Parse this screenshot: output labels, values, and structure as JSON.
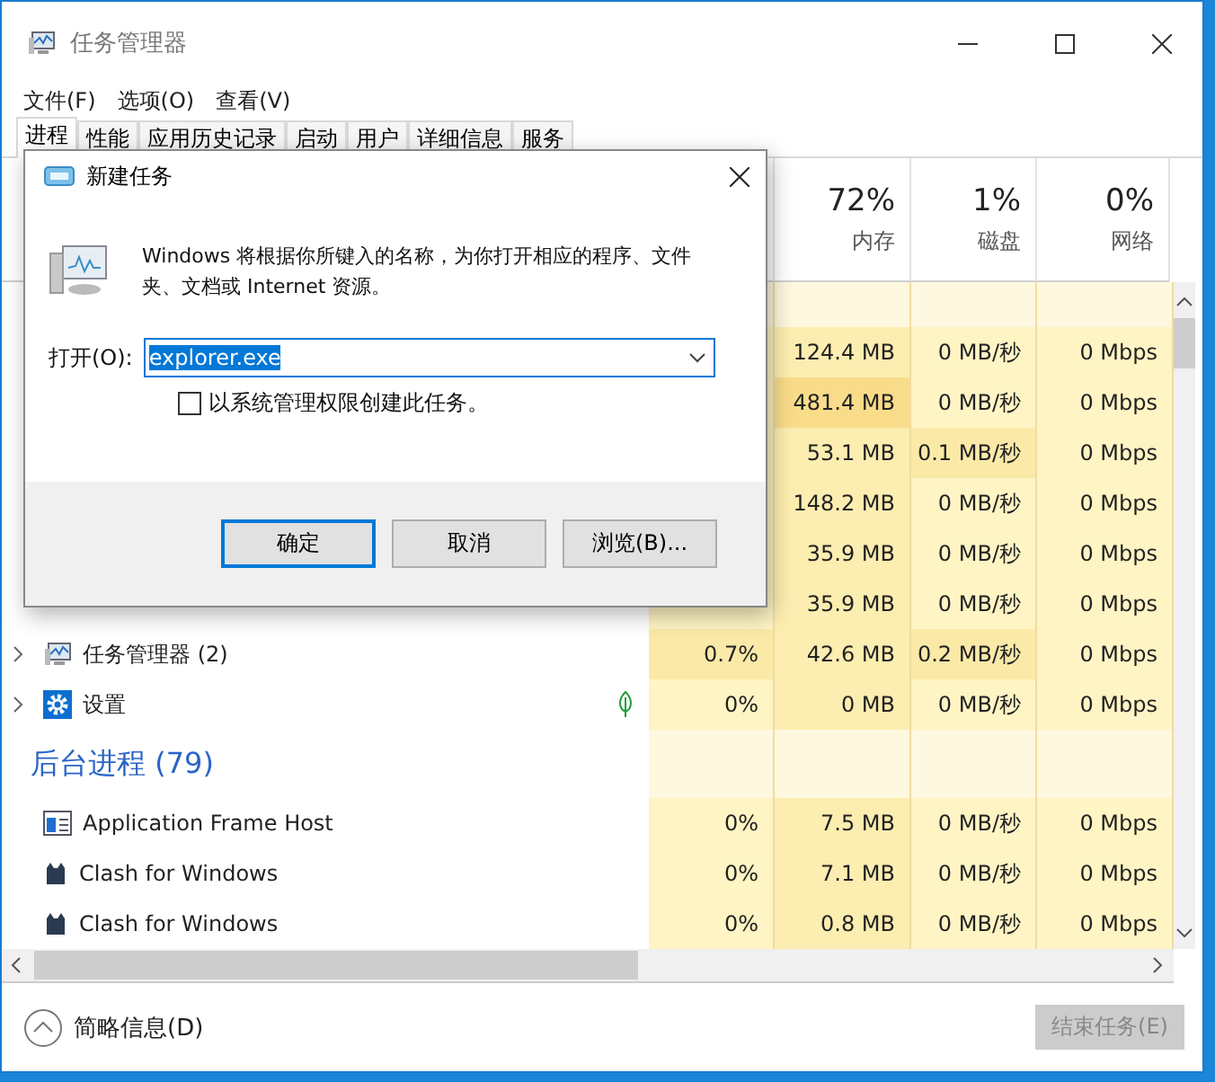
{
  "window": {
    "title": "任务管理器",
    "active": false
  },
  "menu": [
    "文件(F)",
    "选项(O)",
    "查看(V)"
  ],
  "tabs": [
    {
      "label": "进程",
      "selected": true
    },
    {
      "label": "性能",
      "selected": false
    },
    {
      "label": "应用历史记录",
      "selected": false
    },
    {
      "label": "启动",
      "selected": false
    },
    {
      "label": "用户",
      "selected": false
    },
    {
      "label": "详细信息",
      "selected": false
    },
    {
      "label": "服务",
      "selected": false
    }
  ],
  "columns": [
    {
      "value": "72%",
      "label": "内存"
    },
    {
      "value": "1%",
      "label": "磁盘"
    },
    {
      "value": "0%",
      "label": "网络"
    }
  ],
  "rows": [
    {
      "kind": "group"
    },
    {
      "kind": "hidden",
      "mem": {
        "text": "124.4 MB",
        "busy": false
      },
      "disk": {
        "text": "0 MB/秒",
        "busy": false
      },
      "net": {
        "text": "0 Mbps",
        "busy": false
      }
    },
    {
      "kind": "hidden",
      "mem": {
        "text": "481.4 MB",
        "busy": true
      },
      "disk": {
        "text": "0 MB/秒",
        "busy": false
      },
      "net": {
        "text": "0 Mbps",
        "busy": false
      }
    },
    {
      "kind": "hidden",
      "mem": {
        "text": "53.1 MB",
        "busy": false
      },
      "disk": {
        "text": "0.1 MB/秒",
        "busy": true
      },
      "net": {
        "text": "0 Mbps",
        "busy": false
      }
    },
    {
      "kind": "hidden",
      "mem": {
        "text": "148.2 MB",
        "busy": false
      },
      "disk": {
        "text": "0 MB/秒",
        "busy": false
      },
      "net": {
        "text": "0 Mbps",
        "busy": false
      }
    },
    {
      "kind": "hidden",
      "mem": {
        "text": "35.9 MB",
        "busy": false
      },
      "disk": {
        "text": "0 MB/秒",
        "busy": false
      },
      "net": {
        "text": "0 Mbps",
        "busy": false
      }
    },
    {
      "kind": "hidden",
      "mem": {
        "text": "35.9 MB",
        "busy": false
      },
      "disk": {
        "text": "0 MB/秒",
        "busy": false
      },
      "net": {
        "text": "0 Mbps",
        "busy": false
      }
    },
    {
      "kind": "monitor",
      "expandable": true,
      "name": "任务管理器 (2)",
      "cpu": {
        "text": "0.7%",
        "busy": true
      },
      "mem": {
        "text": "42.6 MB",
        "busy": false
      },
      "disk": {
        "text": "0.2 MB/秒",
        "busy": true
      },
      "net": {
        "text": "0 Mbps",
        "busy": false
      }
    },
    {
      "kind": "gear",
      "expandable": true,
      "suspended": true,
      "name": "设置",
      "cpu": {
        "text": "0%",
        "busy": false
      },
      "mem": {
        "text": "0 MB",
        "busy": false
      },
      "disk": {
        "text": "0 MB/秒",
        "busy": false
      },
      "net": {
        "text": "0 Mbps",
        "busy": false
      }
    },
    {
      "kind": "group",
      "name": "后台进程 (79)"
    },
    {
      "kind": "frame",
      "name": "Application Frame Host",
      "cpu": {
        "text": "0%",
        "busy": false
      },
      "mem": {
        "text": "7.5 MB",
        "busy": false
      },
      "disk": {
        "text": "0 MB/秒",
        "busy": false
      },
      "net": {
        "text": "0 Mbps",
        "busy": false
      }
    },
    {
      "kind": "cat",
      "name": "Clash for Windows",
      "cpu": {
        "text": "0%",
        "busy": false
      },
      "mem": {
        "text": "7.1 MB",
        "busy": false
      },
      "disk": {
        "text": "0 MB/秒",
        "busy": false
      },
      "net": {
        "text": "0 Mbps",
        "busy": false
      }
    },
    {
      "kind": "cat",
      "name": "Clash for Windows",
      "cpu": {
        "text": "0%",
        "busy": false
      },
      "mem": {
        "text": "0.8 MB",
        "busy": false
      },
      "disk": {
        "text": "0 MB/秒",
        "busy": false
      },
      "net": {
        "text": "0 Mbps",
        "busy": false
      }
    }
  ],
  "footer": {
    "details": "简略信息(D)",
    "end_task": {
      "label": "结束任务(E)",
      "disabled": true
    }
  },
  "dialog": {
    "title": "新建任务",
    "message": "Windows 将根据你所键入的名称，为你打开相应的程序、文件夹、文档或 Internet 资源。",
    "open_label": "打开(O):",
    "value": "explorer.exe",
    "admin_checkbox": {
      "label": "以系统管理权限创建此任务。",
      "checked": false
    },
    "buttons": [
      {
        "label": "确定",
        "default": true
      },
      {
        "label": "取消",
        "default": false
      },
      {
        "label": "浏览(B)...",
        "default": false
      }
    ]
  }
}
